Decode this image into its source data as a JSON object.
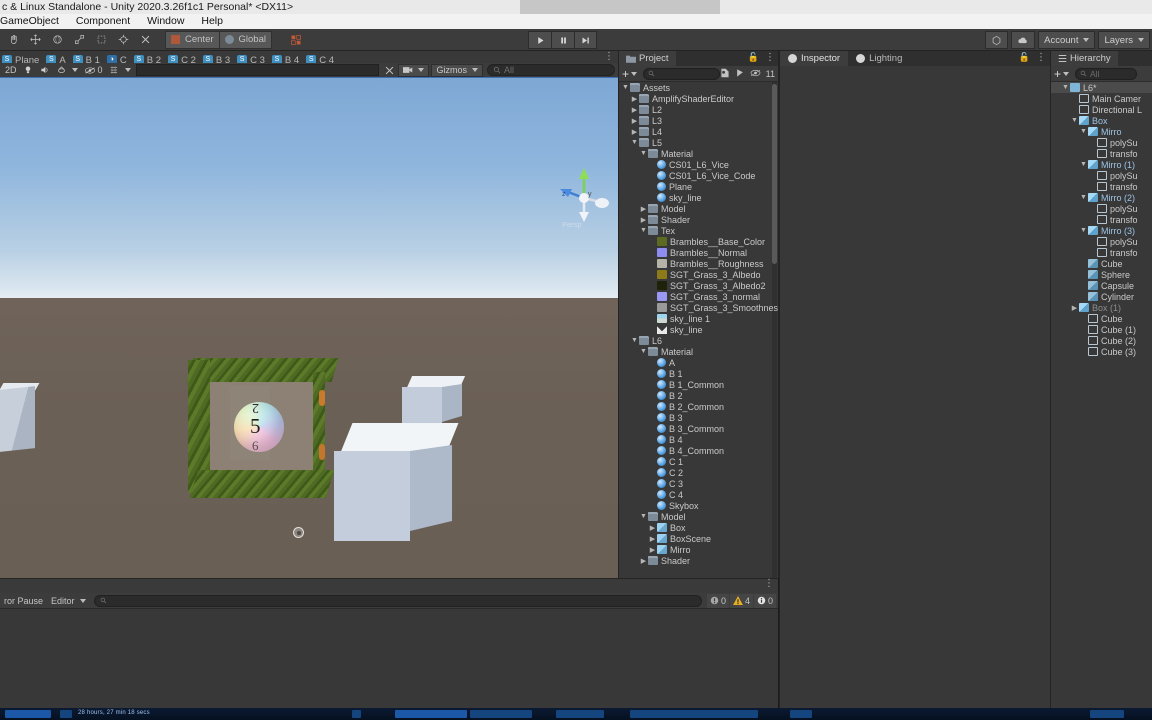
{
  "window": {
    "title": "c & Linux Standalone - Unity 2020.3.26f1c1 Personal* <DX11>"
  },
  "menubar": {
    "items": [
      "GameObject",
      "Component",
      "Window",
      "Help"
    ]
  },
  "toolbar": {
    "transform_tools": [
      "hand-tool",
      "move-tool",
      "rotate-tool",
      "scale-tool",
      "rect-tool",
      "transform-tool",
      "custom-tool"
    ],
    "pivot_mode": "Center",
    "pivot_rotation": "Global",
    "snap_label": "grid-snap",
    "play": "▶",
    "pause": "❙❙",
    "step": "▶|",
    "collab": "collab-icon",
    "cloud": "cloud-icon",
    "account": "Account",
    "layers": "Layers"
  },
  "material_tabs": [
    {
      "badge": "S",
      "label": "Plane",
      "color": "#3f8fbf"
    },
    {
      "badge": "S",
      "label": "A",
      "color": "#3f8fbf"
    },
    {
      "badge": "S",
      "label": "B 1",
      "color": "#3f8fbf"
    },
    {
      "badge": "◑",
      "label": "C",
      "color": "#2f6fa8"
    },
    {
      "badge": "S",
      "label": "B 2",
      "color": "#3f8fbf"
    },
    {
      "badge": "S",
      "label": "C 2",
      "color": "#3f8fbf"
    },
    {
      "badge": "S",
      "label": "B 3",
      "color": "#3f8fbf"
    },
    {
      "badge": "S",
      "label": "C 3",
      "color": "#3f8fbf"
    },
    {
      "badge": "S",
      "label": "B 4",
      "color": "#3f8fbf"
    },
    {
      "badge": "S",
      "label": "C 4",
      "color": "#3f8fbf"
    }
  ],
  "scene_toolbar": {
    "shading_mode": "2D",
    "lighting_toggle": "lightbulb-icon",
    "audio_toggle": "speaker-icon",
    "fx_toggle": "effects-icon",
    "hidden_count": "0",
    "scene_vis": "scene-visibility-icon",
    "gizmos_label": "Gizmos",
    "search_placeholder": "All"
  },
  "scene": {
    "gizmo_axes": [
      "x",
      "y",
      "z"
    ],
    "projection_label": "Persp",
    "objects": {
      "sphere_numbers": {
        "top": "2",
        "middle": "5",
        "bottom": "6"
      }
    }
  },
  "console": {
    "clear_on_pause": "ror Pause",
    "mode": "Editor",
    "search_placeholder": "",
    "counts": {
      "errors": "0",
      "warnings": "4",
      "infos": "0"
    }
  },
  "inspector": {
    "tabs": [
      {
        "label": "Inspector",
        "icon": "info-icon",
        "active": true
      },
      {
        "label": "Lighting",
        "icon": "lightbulb-icon",
        "active": false
      }
    ],
    "lock": "lock-icon",
    "menu": "kebab-menu-icon"
  },
  "project": {
    "tab": "Project",
    "lock": "lock-icon",
    "menu": "kebab-menu-icon",
    "create_label": "+",
    "search_placeholder": "",
    "favorite_icon": "favorite-icon",
    "packages_icon": "packages-icon",
    "visibility_count": "11",
    "tree": [
      {
        "depth": 0,
        "label": "Assets",
        "icon": "folder",
        "tw": "▼"
      },
      {
        "depth": 1,
        "label": "AmplifyShaderEditor",
        "icon": "folder",
        "tw": "▶"
      },
      {
        "depth": 1,
        "label": "L2",
        "icon": "folder",
        "tw": "▶"
      },
      {
        "depth": 1,
        "label": "L3",
        "icon": "folder",
        "tw": "▶"
      },
      {
        "depth": 1,
        "label": "L4",
        "icon": "folder",
        "tw": "▶"
      },
      {
        "depth": 1,
        "label": "L5",
        "icon": "folder",
        "tw": "▼"
      },
      {
        "depth": 2,
        "label": "Material",
        "icon": "folder",
        "tw": "▼"
      },
      {
        "depth": 3,
        "label": "CS01_L6_Vice",
        "icon": "material",
        "tw": ""
      },
      {
        "depth": 3,
        "label": "CS01_L6_Vice_Code",
        "icon": "material",
        "tw": ""
      },
      {
        "depth": 3,
        "label": "Plane",
        "icon": "material",
        "tw": ""
      },
      {
        "depth": 3,
        "label": "sky_line",
        "icon": "material",
        "tw": ""
      },
      {
        "depth": 2,
        "label": "Model",
        "icon": "folder",
        "tw": "▶"
      },
      {
        "depth": 2,
        "label": "Shader",
        "icon": "folder",
        "tw": "▶"
      },
      {
        "depth": 2,
        "label": "Tex",
        "icon": "folder",
        "tw": "▼"
      },
      {
        "depth": 3,
        "label": "Brambles__Base_Color",
        "icon": "tex",
        "color": "#5c6a22",
        "tw": ""
      },
      {
        "depth": 3,
        "label": "Brambles__Normal",
        "icon": "tex",
        "color": "#8e8cf0",
        "tw": ""
      },
      {
        "depth": 3,
        "label": "Brambles__Roughness",
        "icon": "tex",
        "color": "#b5b2a8",
        "tw": ""
      },
      {
        "depth": 3,
        "label": "SGT_Grass_3_Albedo",
        "icon": "tex",
        "color": "#8d7a18",
        "tw": ""
      },
      {
        "depth": 3,
        "label": "SGT_Grass_3_Albedo2",
        "icon": "tex",
        "color": "#1d2208",
        "tw": ""
      },
      {
        "depth": 3,
        "label": "SGT_Grass_3_normal",
        "icon": "tex",
        "color": "#9a98f2",
        "tw": ""
      },
      {
        "depth": 3,
        "label": "SGT_Grass_3_Smoothnes",
        "icon": "tex",
        "color": "#9a9a9a",
        "tw": ""
      },
      {
        "depth": 3,
        "label": "sky_line 1",
        "icon": "sky",
        "tw": ""
      },
      {
        "depth": 3,
        "label": "sky_line",
        "icon": "shader",
        "tw": ""
      },
      {
        "depth": 1,
        "label": "L6",
        "icon": "folder",
        "tw": "▼"
      },
      {
        "depth": 2,
        "label": "Material",
        "icon": "folder",
        "tw": "▼"
      },
      {
        "depth": 3,
        "label": "A",
        "icon": "material",
        "tw": ""
      },
      {
        "depth": 3,
        "label": "B 1",
        "icon": "material",
        "tw": ""
      },
      {
        "depth": 3,
        "label": "B 1_Common",
        "icon": "material",
        "tw": ""
      },
      {
        "depth": 3,
        "label": "B 2",
        "icon": "material",
        "tw": ""
      },
      {
        "depth": 3,
        "label": "B 2_Common",
        "icon": "material",
        "tw": ""
      },
      {
        "depth": 3,
        "label": "B 3",
        "icon": "material",
        "tw": ""
      },
      {
        "depth": 3,
        "label": "B 3_Common",
        "icon": "material",
        "tw": ""
      },
      {
        "depth": 3,
        "label": "B 4",
        "icon": "material",
        "tw": ""
      },
      {
        "depth": 3,
        "label": "B 4_Common",
        "icon": "material",
        "tw": ""
      },
      {
        "depth": 3,
        "label": "C 1",
        "icon": "material",
        "tw": ""
      },
      {
        "depth": 3,
        "label": "C 2",
        "icon": "material",
        "tw": ""
      },
      {
        "depth": 3,
        "label": "C 3",
        "icon": "material",
        "tw": ""
      },
      {
        "depth": 3,
        "label": "C 4",
        "icon": "material",
        "tw": ""
      },
      {
        "depth": 3,
        "label": "Skybox",
        "icon": "material",
        "tw": ""
      },
      {
        "depth": 2,
        "label": "Model",
        "icon": "folder",
        "tw": "▼"
      },
      {
        "depth": 3,
        "label": "Box",
        "icon": "model",
        "tw": "▶"
      },
      {
        "depth": 3,
        "label": "BoxScene",
        "icon": "model",
        "tw": "▶"
      },
      {
        "depth": 3,
        "label": "Mirro",
        "icon": "model",
        "tw": "▶"
      },
      {
        "depth": 2,
        "label": "Shader",
        "icon": "folder",
        "tw": "▶"
      }
    ]
  },
  "hierarchy": {
    "tab": "Hierarchy",
    "create_label": "+",
    "search_placeholder": "All",
    "tree": [
      {
        "depth": 0,
        "label": "L6*",
        "icon": "scene",
        "tw": "▼",
        "sel": true
      },
      {
        "depth": 1,
        "label": "Main Camer",
        "icon": "gameobject",
        "tw": ""
      },
      {
        "depth": 1,
        "label": "Directional L",
        "icon": "gameobject",
        "tw": ""
      },
      {
        "depth": 1,
        "label": "Box",
        "icon": "prefab",
        "tw": "▼",
        "blue": true
      },
      {
        "depth": 2,
        "label": "Mirro",
        "icon": "prefab",
        "tw": "▼",
        "blue": true
      },
      {
        "depth": 3,
        "label": "polySu",
        "icon": "gameobject",
        "tw": ""
      },
      {
        "depth": 3,
        "label": "transfo",
        "icon": "gameobject",
        "tw": ""
      },
      {
        "depth": 2,
        "label": "Mirro (1)",
        "icon": "prefab",
        "tw": "▼",
        "blue": true
      },
      {
        "depth": 3,
        "label": "polySu",
        "icon": "gameobject",
        "tw": ""
      },
      {
        "depth": 3,
        "label": "transfo",
        "icon": "gameobject",
        "tw": ""
      },
      {
        "depth": 2,
        "label": "Mirro (2)",
        "icon": "prefab",
        "tw": "▼",
        "blue": true
      },
      {
        "depth": 3,
        "label": "polySu",
        "icon": "gameobject",
        "tw": ""
      },
      {
        "depth": 3,
        "label": "transfo",
        "icon": "gameobject",
        "tw": ""
      },
      {
        "depth": 2,
        "label": "Mirro (3)",
        "icon": "prefab",
        "tw": "▼",
        "blue": true
      },
      {
        "depth": 3,
        "label": "polySu",
        "icon": "gameobject",
        "tw": ""
      },
      {
        "depth": 3,
        "label": "transfo",
        "icon": "gameobject",
        "tw": ""
      },
      {
        "depth": 2,
        "label": "Cube",
        "icon": "prefab-child",
        "tw": ""
      },
      {
        "depth": 2,
        "label": "Sphere",
        "icon": "prefab-child",
        "tw": ""
      },
      {
        "depth": 2,
        "label": "Capsule",
        "icon": "prefab-child",
        "tw": ""
      },
      {
        "depth": 2,
        "label": "Cylinder",
        "icon": "prefab-child",
        "tw": ""
      },
      {
        "depth": 1,
        "label": "Box (1)",
        "icon": "prefab",
        "tw": "▶",
        "dim": true
      },
      {
        "depth": 2,
        "label": "Cube",
        "icon": "gameobject",
        "tw": ""
      },
      {
        "depth": 2,
        "label": "Cube (1)",
        "icon": "gameobject",
        "tw": ""
      },
      {
        "depth": 2,
        "label": "Cube (2)",
        "icon": "gameobject",
        "tw": ""
      },
      {
        "depth": 2,
        "label": "Cube (3)",
        "icon": "gameobject",
        "tw": ""
      }
    ]
  },
  "taskbar": {
    "session_text": "28 hours, 27 min 18 secs"
  },
  "colors": {
    "accent_blue": "#3f8fbf",
    "panel_bg": "#383838",
    "toolbar_bg": "#3c3c3c",
    "selection": "#4b4b4b",
    "warning": "#e0a020"
  }
}
